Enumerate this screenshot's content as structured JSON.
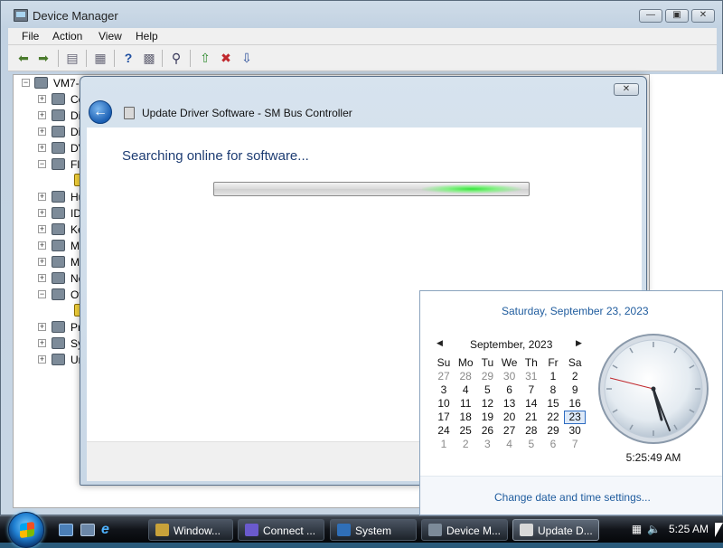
{
  "device_manager": {
    "title": "Device Manager",
    "menu": [
      "File",
      "Action",
      "View",
      "Help"
    ],
    "toolbar_icons": [
      "back-arrow-icon",
      "forward-arrow-icon",
      "properties-icon",
      "show-hide-icon",
      "help-icon",
      "console-tree-icon",
      "scan-hardware-icon",
      "update-driver-icon",
      "uninstall-icon",
      "disable-icon"
    ],
    "tree": {
      "root": "VM7-",
      "items": [
        {
          "label": "Co",
          "expanded": false
        },
        {
          "label": "Di",
          "expanded": false
        },
        {
          "label": "Di",
          "expanded": false
        },
        {
          "label": "DV",
          "expanded": false
        },
        {
          "label": "Fl",
          "expanded": true
        },
        {
          "label": "",
          "child": true
        },
        {
          "label": "Hu",
          "expanded": false
        },
        {
          "label": "ID",
          "expanded": false
        },
        {
          "label": "Ke",
          "expanded": false
        },
        {
          "label": "Mi",
          "expanded": false
        },
        {
          "label": "Mo",
          "expanded": false
        },
        {
          "label": "Ne",
          "expanded": false
        },
        {
          "label": "Ot",
          "expanded": true
        },
        {
          "label": "",
          "child": true
        },
        {
          "label": "Pr",
          "expanded": false
        },
        {
          "label": "Sy",
          "expanded": false
        },
        {
          "label": "Ur",
          "expanded": false
        }
      ]
    }
  },
  "dialog": {
    "title": "Update Driver Software - SM Bus Controller",
    "heading": "Searching online for software...",
    "close_label": "✕",
    "back_label": "←"
  },
  "flyout": {
    "long_date": "Saturday, September 23, 2023",
    "month_label": "September, 2023",
    "weekdays": [
      "Su",
      "Mo",
      "Tu",
      "We",
      "Th",
      "Fr",
      "Sa"
    ],
    "weeks": [
      [
        "27",
        "28",
        "29",
        "30",
        "31",
        "1",
        "2"
      ],
      [
        "3",
        "4",
        "5",
        "6",
        "7",
        "8",
        "9"
      ],
      [
        "10",
        "11",
        "12",
        "13",
        "14",
        "15",
        "16"
      ],
      [
        "17",
        "18",
        "19",
        "20",
        "21",
        "22",
        "23"
      ],
      [
        "24",
        "25",
        "26",
        "27",
        "28",
        "29",
        "30"
      ],
      [
        "1",
        "2",
        "3",
        "4",
        "5",
        "6",
        "7"
      ]
    ],
    "today": "23",
    "time": "5:25:49 AM",
    "settings_link": "Change date and time settings...",
    "prev_arrow": "◀",
    "next_arrow": "▶"
  },
  "taskbar": {
    "buttons": [
      {
        "label": "Window...",
        "color": "#c8a23a"
      },
      {
        "label": "Connect ...",
        "color": "#6a5acd"
      },
      {
        "label": "System",
        "color": "#2f6fb8"
      },
      {
        "label": "Device M...",
        "color": "#7d8b99"
      },
      {
        "label": "Update D...",
        "color": "#d8d8d8"
      }
    ],
    "clock": "5:25 AM"
  }
}
